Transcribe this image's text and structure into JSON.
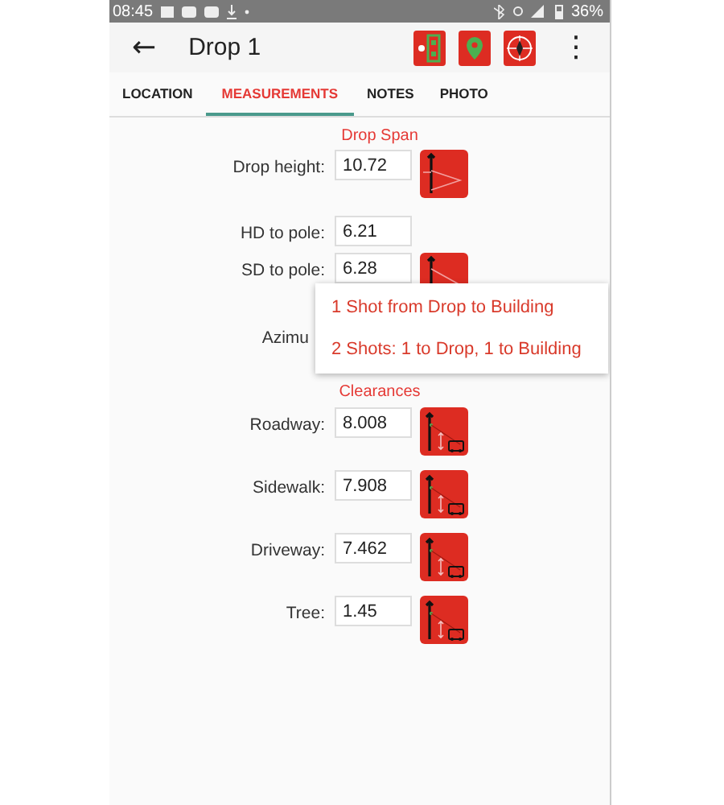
{
  "status_bar": {
    "time": "08:45",
    "battery": "36%"
  },
  "app_bar": {
    "back": "←",
    "title": "Drop 1",
    "overflow": "⋮",
    "actions": [
      {
        "kind": "battery"
      },
      {
        "kind": "pin"
      },
      {
        "kind": "compass"
      }
    ]
  },
  "tabs": [
    {
      "label": "LOCATION",
      "selected": false
    },
    {
      "label": "MEASUREMENTS",
      "selected": true
    },
    {
      "label": "NOTES",
      "selected": false
    },
    {
      "label": "PHOTO",
      "selected": false
    }
  ],
  "sections": [
    {
      "title": "Drop Span",
      "rows": [
        {
          "label": "Drop height:",
          "value": "10.72",
          "kind": "drop"
        },
        {
          "label": "HD to pole:",
          "value": "6.21",
          "kind": "plain"
        },
        {
          "label": "SD to pole:",
          "value": "6.28",
          "kind": "slope"
        },
        {
          "label": "Azimu",
          "kind": "hidden"
        }
      ]
    },
    {
      "title": "Clearances",
      "rows": [
        {
          "label": "Roadway:",
          "value": "8.008",
          "kind": "clearance"
        },
        {
          "label": "Sidewalk:",
          "value": "7.908",
          "kind": "clearance"
        },
        {
          "label": "Driveway:",
          "value": "7.462",
          "kind": "clearance"
        },
        {
          "label": "Tree:",
          "value": "1.45",
          "kind": "clearance"
        }
      ]
    }
  ],
  "menu": {
    "items": [
      "1 Shot from Drop to Building",
      "2 Shots: 1 to Drop, 1 to Building"
    ]
  }
}
